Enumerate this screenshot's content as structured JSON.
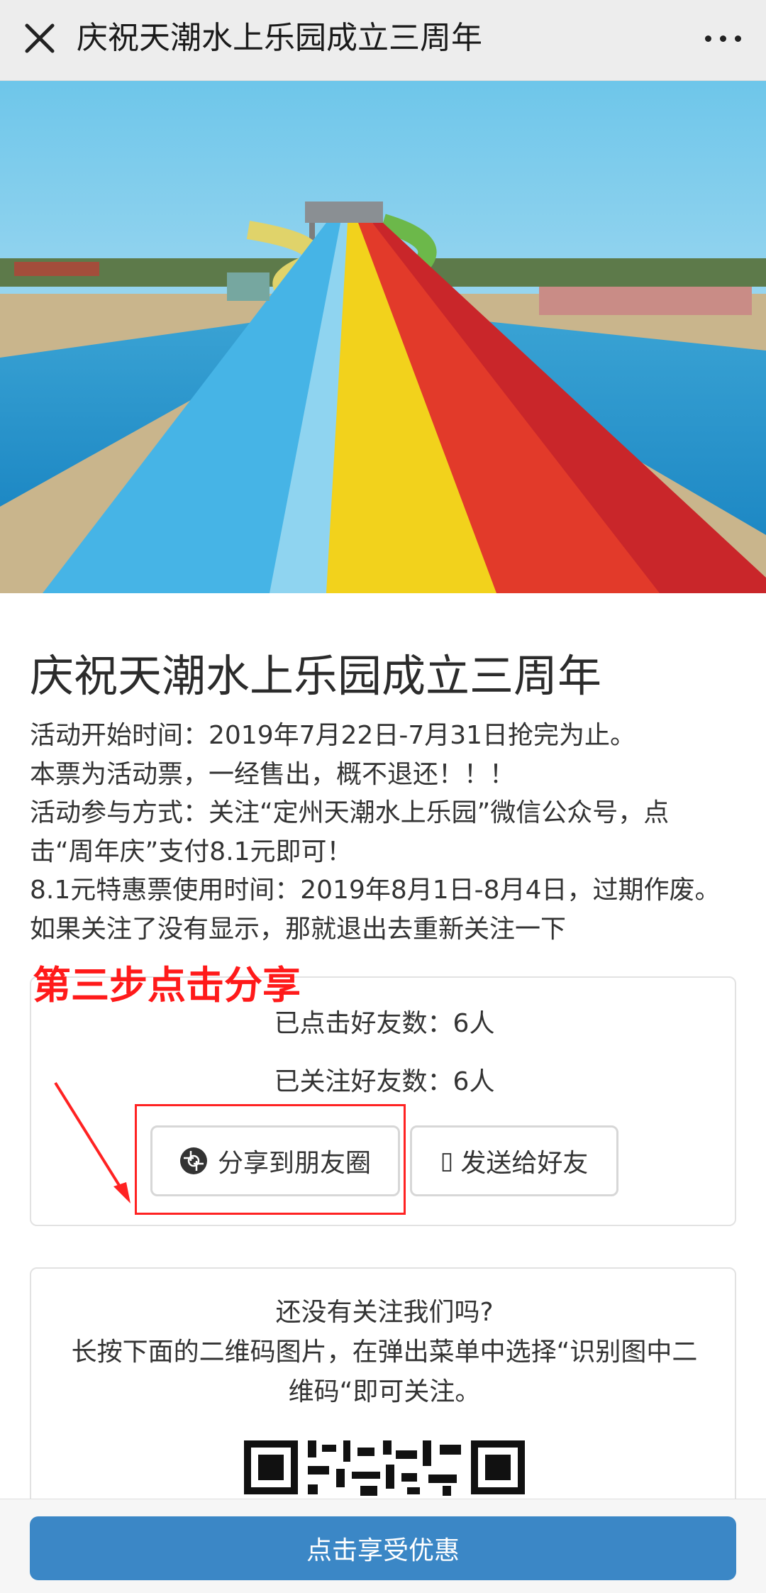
{
  "topbar": {
    "title": "庆祝天潮水上乐园成立三周年",
    "close_icon": "close-icon",
    "more_icon": "more-icon"
  },
  "hero": {
    "image": "water-slide-photo"
  },
  "article": {
    "title": "庆祝天潮水上乐园成立三周年",
    "lines": [
      "活动开始时间：2019年7月22日-7月31日抢完为止。",
      "本票为活动票，一经售出，概不退还！！！",
      "活动参与方式：关注“定州天潮水上乐园”微信公众号，点",
      "击“周年庆”支付8.1元即可！",
      "8.1元特惠票使用时间：2019年8月1日-8月4日，过期作废。",
      "如果关注了没有显示，那就退出去重新关注一下"
    ]
  },
  "share": {
    "step_label": "第三步点击分享",
    "clicked_friends": "已点击好友数：6人",
    "followed_friends": "已关注好友数：6人",
    "moments_button": "分享到朋友圈",
    "friend_button": "发送给好友",
    "friend_glyph": "▯"
  },
  "follow": {
    "question": "还没有关注我们吗?",
    "instruction": "长按下面的二维码图片，在弹出菜单中选择“识别图中二维码“即可关注。"
  },
  "bottom": {
    "cta_label": "点击享受优惠",
    "cta_color": "#3b87c6"
  },
  "colors": {
    "highlight": "#ff2222",
    "step_text": "#ff1a1a"
  }
}
